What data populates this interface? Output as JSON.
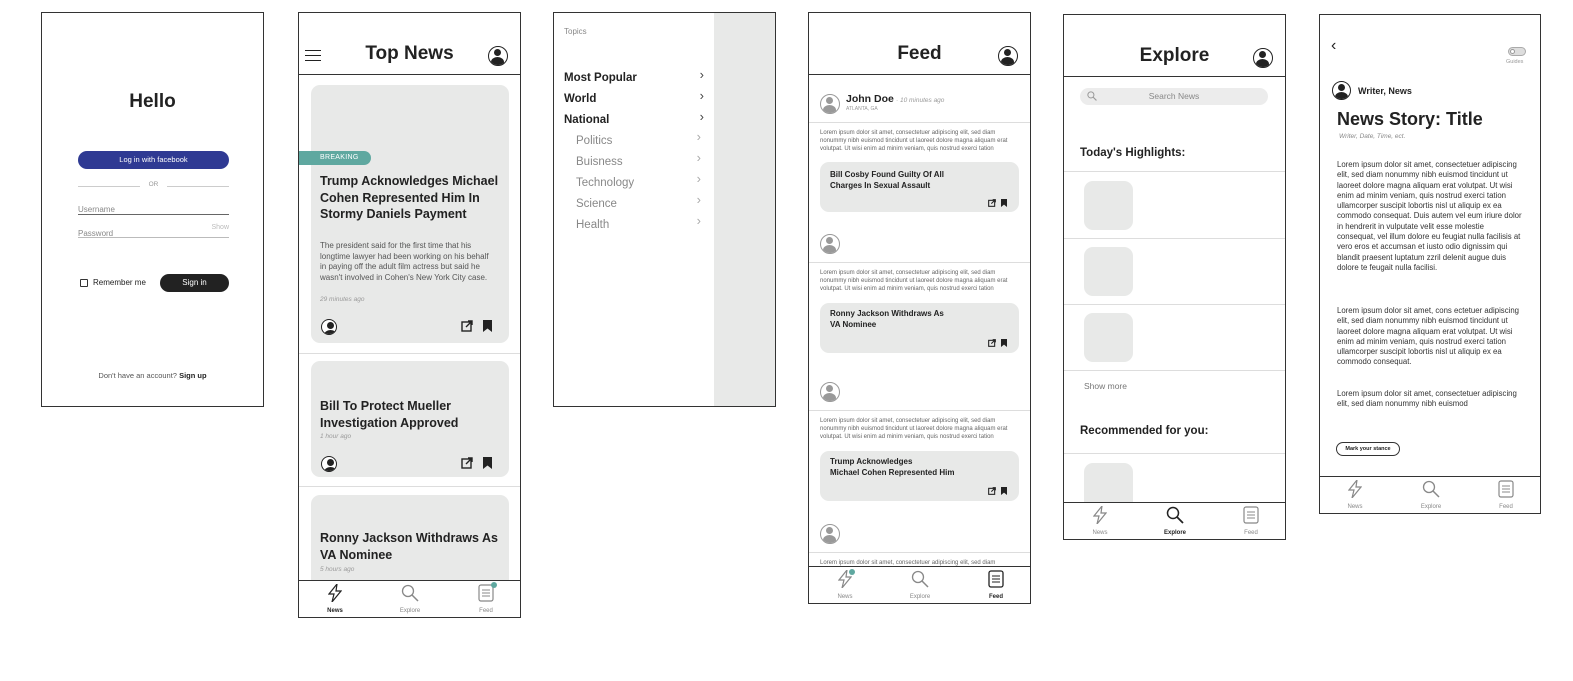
{
  "login": {
    "title": "Hello",
    "facebook_label": "Log in with facebook",
    "or_label": "OR",
    "username_placeholder": "Username",
    "password_placeholder": "Password",
    "show_label": "Show",
    "remember_label": "Remember me",
    "signin_label": "Sign in",
    "no_account_text": "Don't have an account?",
    "signup_label": "Sign up"
  },
  "top_news": {
    "title": "Top News",
    "breaking_badge": "BREAKING",
    "stories": [
      {
        "headline": "Trump Acknowledges Michael Cohen Represented Him In Stormy Daniels Payment",
        "summary": "The president said for the first time that his longtime lawyer had been working on his behalf in paying off the adult film actress but said he wasn't involved in Cohen's New York City case.",
        "time": "29 minutes ago"
      },
      {
        "headline": "Bill To Protect Mueller Investigation Approved",
        "time": "1 hour ago"
      },
      {
        "headline": "Ronny Jackson Withdraws As VA Nominee",
        "time": "5 hours ago"
      }
    ]
  },
  "topics": {
    "header": "Topics",
    "main": [
      "Most Popular",
      "World",
      "National"
    ],
    "sub": [
      "Politics",
      "Buisness",
      "Technology",
      "Science",
      "Health"
    ]
  },
  "feed": {
    "title": "Feed",
    "user_name": "John Doe",
    "post_time": "· 10 minutes ago",
    "location": "ATLANTA, GA",
    "lorem": "Lorem ipsum dolor sit amet, consectetuer adipiscing elit, sed diam nonummy nibh euismod tincidunt ut laoreet dolore magna aliquam erat volutpat. Ut wisi enim ad minim veniam, quis nostrud exerci tation ullamcorper suscipit lobortis nisl ut aliquip ex ea commodo consequat.",
    "lorem_cut": "Lorem ipsum dolor sit amet, consectetuer adipiscing elit, sed diam",
    "shared": [
      {
        "line1": "Bill Cosby Found Guilty Of All",
        "line2": "Charges In Sexual Assault"
      },
      {
        "line1": "Ronny Jackson Withdraws As",
        "line2": "VA Nominee"
      },
      {
        "line1": "Trump Acknowledges",
        "line2": "Michael Cohen Represented Him"
      }
    ]
  },
  "explore": {
    "title": "Explore",
    "search_placeholder": "Search News",
    "highlights_heading": "Today's Highlights:",
    "show_more": "Show more",
    "recommended_heading": "Recommended for you:"
  },
  "story": {
    "guides_label": "Guides",
    "author": "Writer, News",
    "title": "News Story: Title",
    "meta": "Writer, Date, Time, ect.",
    "para1": "Lorem ipsum dolor sit amet, consectetuer adipiscing elit, sed diam nonummy nibh euismod tincidunt ut laoreet dolore magna aliquam erat volutpat. Ut wisi enim ad minim veniam, quis nostrud exerci tation ullamcorper suscipit lobortis nisl ut aliquip ex ea commodo consequat. Duis autem vel eum iriure dolor in hendrerit in vulputate velit esse molestie consequat, vel illum dolore eu feugiat nulla facilisis at vero eros et accumsan et iusto odio dignissim qui blandit praesent luptatum zzril delenit augue duis dolore te feugait nulla facilisi.",
    "para2": "Lorem ipsum dolor sit amet, cons ectetuer adipiscing elit, sed diam nonummy nibh euismod tincidunt ut laoreet dolore magna aliquam erat volutpat. Ut wisi enim ad minim veniam, quis nostrud exerci tation ullamcorper suscipit lobortis nisl ut aliquip ex ea commodo consequat.",
    "para3": "Lorem ipsum dolor sit amet, consectetuer adipiscing elit, sed diam nonummy nibh euismod",
    "stance_label": "Mark your stance"
  },
  "tabs": {
    "news": "News",
    "explore": "Explore",
    "feed": "Feed"
  },
  "colors": {
    "facebook": "#2f3a93",
    "breaking": "#5fa8a0",
    "card": "#e8e9e8",
    "dark_button": "#222222",
    "notification_dot": "#5fa8a0"
  }
}
